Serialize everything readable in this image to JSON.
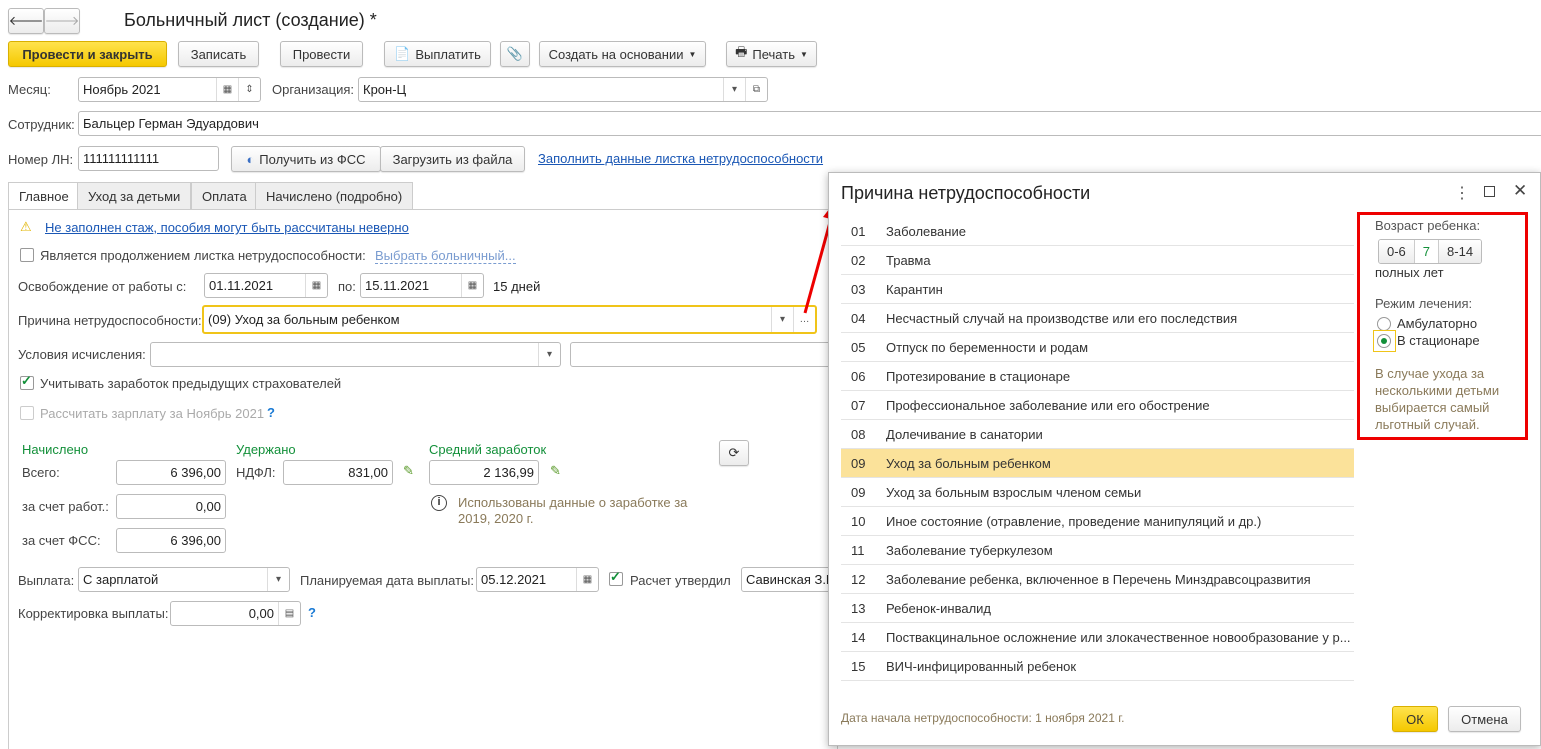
{
  "header": {
    "title": "Больничный лист (создание) *"
  },
  "toolbar": {
    "post_close": "Провести и закрыть",
    "save": "Записать",
    "post": "Провести",
    "pay": "Выплатить",
    "create_based": "Создать на основании",
    "print": "Печать"
  },
  "fields": {
    "month_label": "Месяц:",
    "month": "Ноябрь 2021",
    "org_label": "Организация:",
    "org": "Крон-Ц",
    "employee_label": "Сотрудник:",
    "employee": "Бальцер Герман Эдуардович",
    "ln_label": "Номер ЛН:",
    "ln": "111111111111",
    "get_fss": "Получить из ФСС",
    "load_file": "Загрузить из файла",
    "fill_link": "Заполнить данные листка нетрудоспособности"
  },
  "tabs": [
    "Главное",
    "Уход за детьми",
    "Оплата",
    "Начислено (подробно)"
  ],
  "main": {
    "warning": "Не заполнен стаж, пособия могут быть рассчитаны неверно",
    "continuation": "Является продолжением листка нетрудоспособности:",
    "choose_sick": "Выбрать больничный...",
    "release_label": "Освобождение от работы с:",
    "date_from": "01.11.2021",
    "to_label": "по:",
    "date_to": "15.11.2021",
    "days": "15 дней",
    "reason_label": "Причина нетрудоспособности:",
    "reason": "(09) Уход за больным ребенком",
    "conditions_label": "Условия исчисления:",
    "consider_prev": "Учитывать заработок предыдущих страхователей",
    "calc_salary": "Рассчитать зарплату за Ноябрь 2021",
    "help": "?",
    "accrued_h": "Начислено",
    "withheld_h": "Удержано",
    "avg_h": "Средний заработок",
    "total_label": "Всего:",
    "total": "6 396,00",
    "ndfl_label": "НДФЛ:",
    "ndfl": "831,00",
    "avg": "2 136,99",
    "employer_label": "за счет работ.:",
    "employer": "0,00",
    "fss_label": "за счет ФСС:",
    "fss": "6 396,00",
    "info": "Использованы данные о заработке за 2019,  2020 г.",
    "payout_label": "Выплата:",
    "payout": "С зарплатой",
    "plan_date_label": "Планируемая дата выплаты:",
    "plan_date": "05.12.2021",
    "approved_label": "Расчет утвердил",
    "approved": "Савинская З.Г",
    "correction_label": "Корректировка выплаты:",
    "correction": "0,00"
  },
  "dialog": {
    "title": "Причина нетрудоспособности",
    "items": [
      [
        "01",
        "Заболевание"
      ],
      [
        "02",
        "Травма"
      ],
      [
        "03",
        "Карантин"
      ],
      [
        "04",
        "Несчастный случай на производстве или его последствия"
      ],
      [
        "05",
        "Отпуск по беременности и родам"
      ],
      [
        "06",
        "Протезирование в стационаре"
      ],
      [
        "07",
        "Профессиональное заболевание или его обострение"
      ],
      [
        "08",
        "Долечивание в санатории"
      ],
      [
        "09",
        "Уход за больным ребенком"
      ],
      [
        "09",
        "Уход за больным взрослым членом семьи"
      ],
      [
        "10",
        "Иное состояние (отравление, проведение манипуляций и др.)"
      ],
      [
        "11",
        "Заболевание туберкулезом"
      ],
      [
        "12",
        "Заболевание ребенка, включенное в Перечень Минздравсоцразвития"
      ],
      [
        "13",
        "Ребенок-инвалид"
      ],
      [
        "14",
        "Поствакцинальное осложнение или злокачественное новообразование у р..."
      ],
      [
        "15",
        "ВИЧ-инфицированный ребенок"
      ]
    ],
    "selected_index": 8,
    "age_label": "Возраст ребенка:",
    "ages": [
      "0-6",
      "7",
      "8-14"
    ],
    "age_unit": "полных лет",
    "mode_label": "Режим лечения:",
    "mode_outpatient": "Амбулаторно",
    "mode_inpatient": "В стационаре",
    "note": "В случае ухода за несколькими детьми выбирается самый льготный случай.",
    "footer": "Дата начала нетрудоспособности: 1 ноября 2021 г.",
    "ok": "ОК",
    "cancel": "Отмена"
  }
}
